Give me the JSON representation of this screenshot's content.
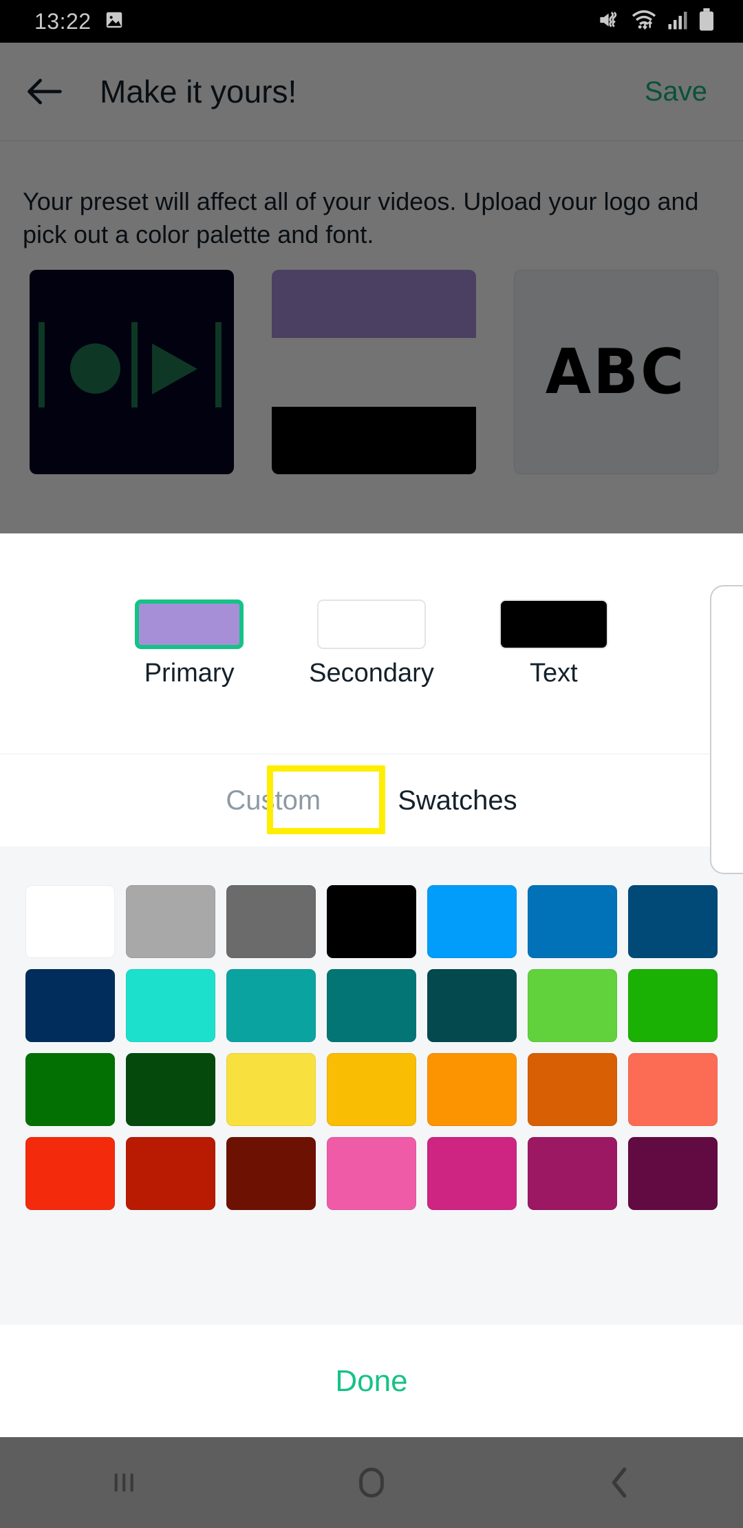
{
  "status_bar": {
    "time": "13:22",
    "left_icons": [
      "image-icon"
    ],
    "right_icons": [
      "mute-vibrate-icon",
      "wifi-icon",
      "cellular-signal-icon",
      "battery-icon"
    ]
  },
  "app": {
    "title": "Make it yours!",
    "back_icon": "back-arrow-icon",
    "save_label": "Save",
    "save_color": "#16b380",
    "description": "Your preset will affect all of your videos. Upload your logo and pick out a color palette and font.",
    "previews": {
      "logo": {
        "name": "logo-preview",
        "background": "#030422",
        "accent": "#1f7a52"
      },
      "palette": {
        "name": "palette-preview",
        "bands": [
          "#a78fd8",
          "#ffffff",
          "#000000"
        ]
      },
      "font": {
        "name": "font-preview",
        "sample_text": "ABC"
      }
    }
  },
  "sheet": {
    "color_targets": [
      {
        "label": "Primary",
        "color": "#a78fd8",
        "selected": true
      },
      {
        "label": "Secondary",
        "color": "#ffffff",
        "selected": false
      },
      {
        "label": "Text",
        "color": "#000000",
        "selected": false
      }
    ],
    "selection_border_color": "#16c286",
    "tabs": [
      {
        "label": "Custom",
        "active": false
      },
      {
        "label": "Swatches",
        "active": true
      }
    ],
    "highlight_color": "#ffee00",
    "highlighted_tab": "Swatches",
    "done_label": "Done",
    "done_color": "#16c286",
    "swatch_rows": [
      [
        "#ffffff",
        "#a8a8a8",
        "#6b6b6b",
        "#000000",
        "#029dfa",
        "#0272b8",
        "#014a78"
      ],
      [
        "#012d5c",
        "#1ce0cc",
        "#0ba3a0",
        "#047575",
        "#04494d",
        "#62d23c",
        "#1bb004"
      ],
      [
        "#037004",
        "#054a0c",
        "#f8e13e",
        "#f9bd04",
        "#fc9402",
        "#d85f03",
        "#fc6c54"
      ],
      [
        "#f42a0c",
        "#b81a02",
        "#6d1102",
        "#ef5ba7",
        "#ce2482",
        "#9c1863",
        "#620b42"
      ]
    ]
  },
  "nav_bar": {
    "buttons": [
      {
        "name": "recents-button",
        "icon": "recents-icon"
      },
      {
        "name": "home-button",
        "icon": "home-icon"
      },
      {
        "name": "back-button",
        "icon": "back-chevron-icon"
      }
    ]
  }
}
